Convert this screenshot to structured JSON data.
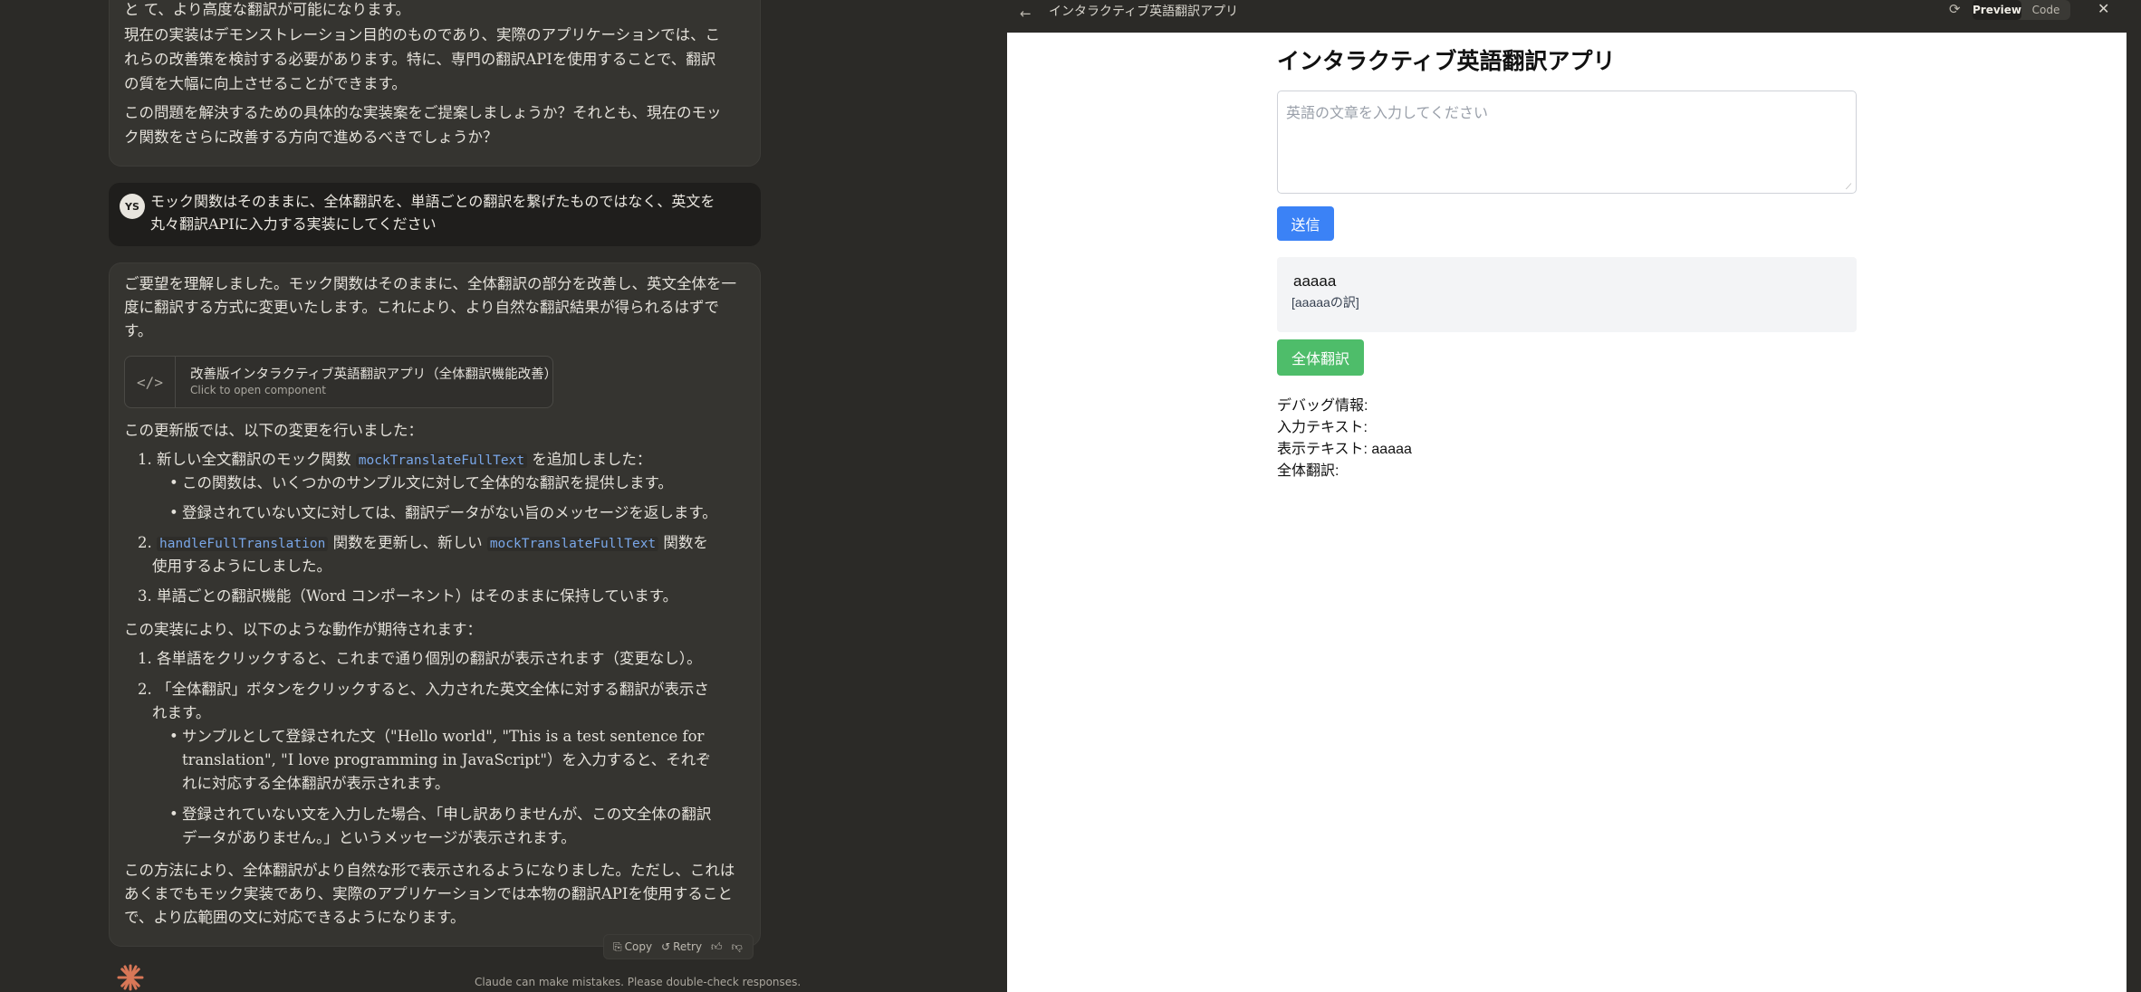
{
  "chat": {
    "previous": {
      "line_top": "と て、より高度な翻訳が可能になります。",
      "para1": "現在の実装はデモンストレーション目的のものであり、実際のアプリケーションでは、これらの改善策を検討する必要があります。特に、専門の翻訳APIを使用することで、翻訳の質を大幅に向上させることができます。",
      "para2": "この問題を解決するための具体的な実装案をご提案しましょうか？それとも、現在のモック関数をさらに改善する方向で進めるべきでしょうか？"
    },
    "user": {
      "avatar": "YS",
      "text": "モック関数はそのままに、全体翻訳を、単語ごとの翻訳を繋げたものではなく、英文を丸々翻訳APIに入力する実装にしてください"
    },
    "reply": {
      "intro": "ご要望を理解しました。モック関数はそのままに、全体翻訳の部分を改善し、英文全体を一度に翻訳する方式に変更いたします。これにより、より自然な翻訳結果が得られるはずです。",
      "artifact_title": "改善版インタラクティブ英語翻訳アプリ（全体翻訳機能改善）",
      "artifact_sub": "Click to open component",
      "changes_intro": "この更新版では、以下の変更を行いました：",
      "item1_pre": "新しい全文翻訳のモック関数 ",
      "item1_code": "mockTranslateFullText",
      "item1_post": " を追加しました：",
      "item1_b1": "この関数は、いくつかのサンプル文に対して全体的な翻訳を提供します。",
      "item1_b2": "登録されていない文に対しては、翻訳データがない旨のメッセージを返します。",
      "item2_code": "handleFullTranslation",
      "item2_mid": " 関数を更新し、新しい ",
      "item2_code2": "mockTranslateFullText",
      "item2_post": " 関数を",
      "item2_line2": "使用するようにしました。",
      "item3": "単語ごとの翻訳機能（Word コンポーネント）はそのままに保持しています。",
      "behavior_intro": "この実装により、以下のような動作が期待されます：",
      "b_item1": "各単語をクリックすると、これまで通り個別の翻訳が表示されます（変更なし）。",
      "b_item2": "「全体翻訳」ボタンをクリックすると、入力された英文全体に対する翻訳が表示されます。",
      "b_item2_b1": "サンプルとして登録された文（\"Hello world\", \"This is a test sentence for translation\", \"I love programming in JavaScript\"）を入力すると、それぞれに対応する全体翻訳が表示されます。",
      "b_item2_b2": "登録されていない文を入力した場合、「申し訳ありませんが、この文全体の翻訳データがありません。」というメッセージが表示されます。",
      "conclusion": "この方法により、全体翻訳がより自然な形で表示されるようになりました。ただし、これはあくまでもモック実装であり、実際のアプリケーションでは本物の翻訳APIを使用することで、より広範囲の文に対応できるようになります。"
    },
    "actions": {
      "copy": "Copy",
      "retry": "Retry"
    },
    "disclaimer": "Claude can make mistakes. Please double-check responses."
  },
  "preview": {
    "topbar_title": "インタラクティブ英語翻訳アプリ",
    "tab_preview": "Preview",
    "tab_code": "Code",
    "app_title": "インタラクティブ英語翻訳アプリ",
    "input_placeholder": "英語の文章を入力してください",
    "send_label": "送信",
    "result_word": "aaaaa",
    "result_translation": "[aaaaaの訳]",
    "full_translate_label": "全体翻訳",
    "debug_title": "デバッグ情報:",
    "debug_input": "入力テキスト:",
    "debug_display": "表示テキスト: aaaaa",
    "debug_full": "全体翻訳:"
  },
  "colors": {
    "send_button": "#3b82f6",
    "full_translate_button": "#4ebd6a",
    "code_text": "#7aa7e8",
    "claude_logo": "#d97757"
  }
}
